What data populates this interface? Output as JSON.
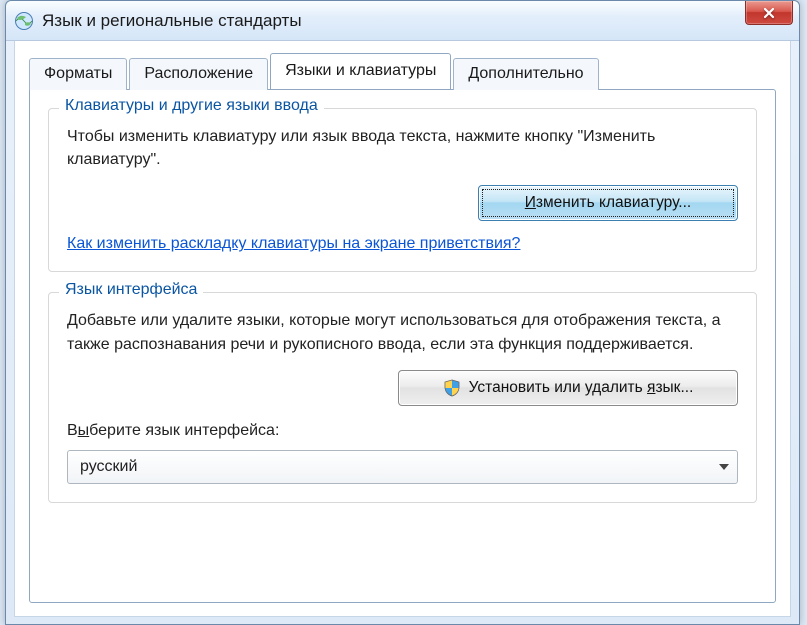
{
  "window": {
    "title": "Язык и региональные стандарты"
  },
  "tabs": {
    "t0": "Форматы",
    "t1": "Расположение",
    "t2": "Языки и клавиатуры",
    "t3": "Дополнительно"
  },
  "group1": {
    "title": "Клавиатуры и другие языки ввода",
    "text": "Чтобы изменить клавиатуру или язык ввода текста, нажмите кнопку \"Изменить клавиатуру\".",
    "button_pre": "И",
    "button_post": "зменить клавиатуру...",
    "link": "Как изменить раскладку клавиатуры на экране приветствия?"
  },
  "group2": {
    "title": "Язык интерфейса",
    "text": "Добавьте или удалите языки, которые могут использоваться для отображения текста, а также распознавания речи и рукописного ввода, если эта функция поддерживается.",
    "button_pre": "Установить или удалить ",
    "button_u": "я",
    "button_post": "зык...",
    "select_label_pre": "В",
    "select_label_u": "ы",
    "select_label_post": "берите язык интерфейса:",
    "selected": "русский"
  }
}
